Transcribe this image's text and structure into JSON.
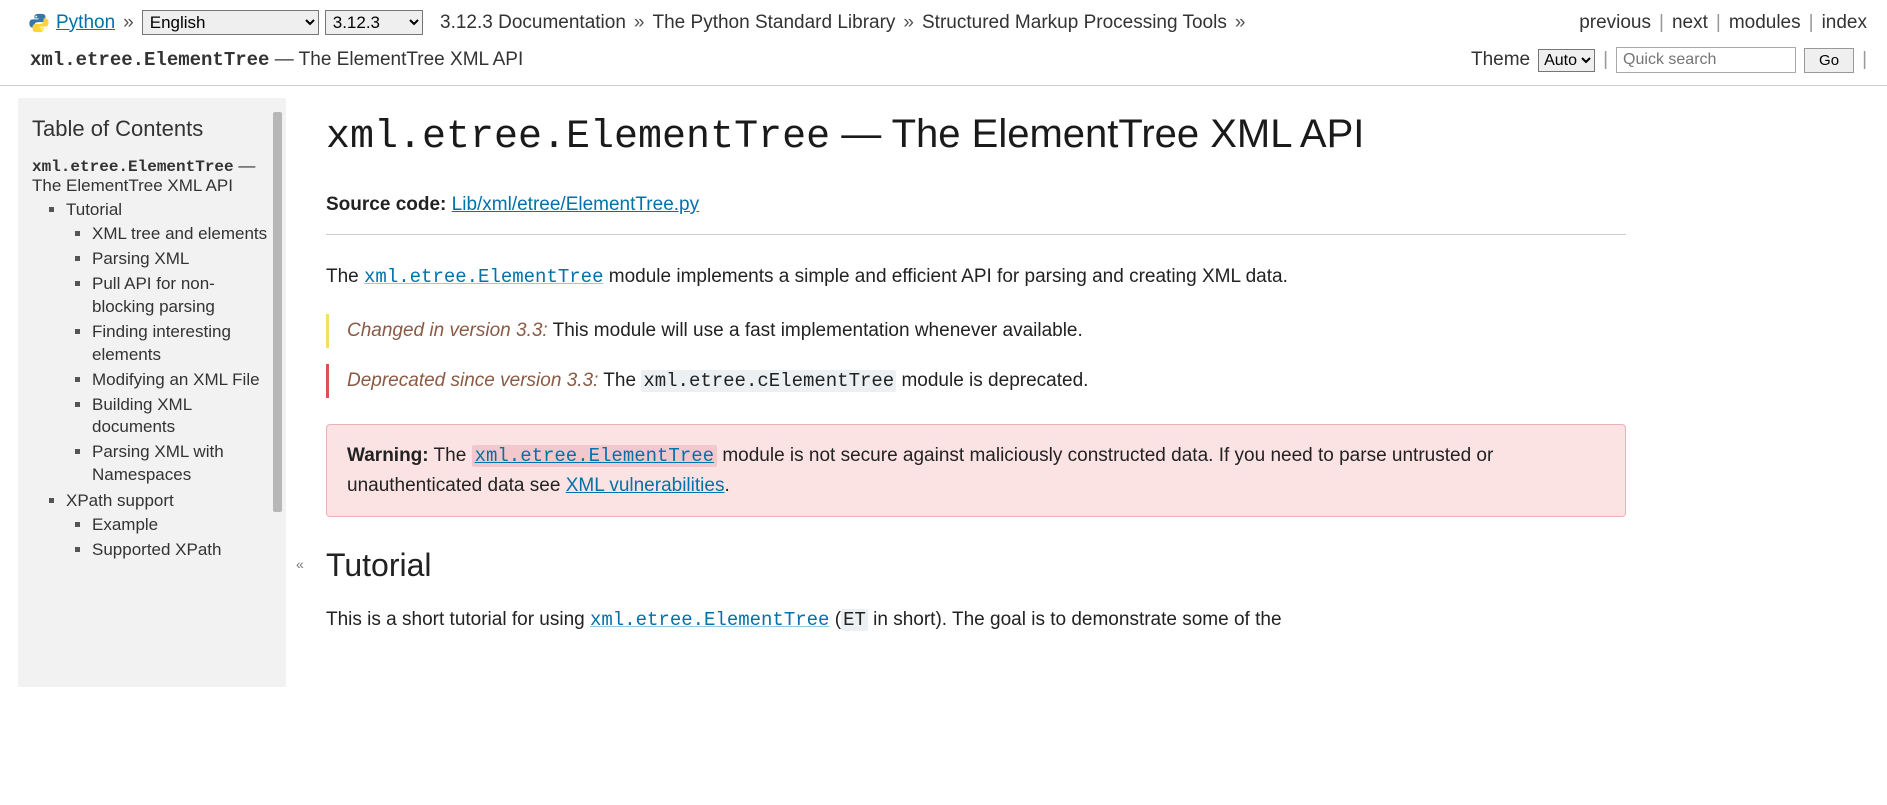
{
  "topnav": {
    "python_link": "Python",
    "lang_selected": "English",
    "ver_selected": "3.12.3",
    "breadcrumbs": [
      "3.12.3 Documentation",
      "The Python Standard Library",
      "Structured Markup Processing Tools"
    ],
    "right_links": {
      "previous": "previous",
      "next": "next",
      "modules": "modules",
      "index": "index"
    }
  },
  "secondbar": {
    "module": "xml.etree.ElementTree",
    "title_suffix": " — The ElementTree XML API",
    "theme_label": "Theme",
    "theme_selected": "Auto",
    "search_placeholder": "Quick search",
    "go": "Go"
  },
  "sidebar": {
    "heading": "Table of Contents",
    "root_mod": "xml.etree.ElementTree",
    "root_suffix": " — The ElementTree XML API",
    "items": {
      "tutorial": "Tutorial",
      "tut_children": [
        "XML tree and elements",
        "Parsing XML",
        "Pull API for non-blocking parsing",
        "Finding interesting elements",
        "Modifying an XML File",
        "Building XML documents",
        "Parsing XML with Namespaces"
      ],
      "xpath": "XPath support",
      "xpath_children": [
        "Example",
        "Supported XPath"
      ]
    }
  },
  "content": {
    "h1_mod": "xml.etree.ElementTree",
    "h1_suffix": " — The ElementTree XML API",
    "source_label": "Source code:",
    "source_link": "Lib/xml/etree/ElementTree.py",
    "intro_pre": "The ",
    "intro_mod": "xml.etree.ElementTree",
    "intro_post": " module implements a simple and efficient API for parsing and creating XML data.",
    "changed_label": "Changed in version 3.3:",
    "changed_text": " This module will use a fast implementation whenever available.",
    "deprecated_label": "Deprecated since version 3.3:",
    "deprecated_pre": " The ",
    "deprecated_mod": "xml.etree.cElementTree",
    "deprecated_post": " module is deprecated.",
    "warning_label": "Warning:",
    "warning_pre": "   The ",
    "warning_mod": "xml.etree.ElementTree",
    "warning_mid": " module is not secure against maliciously constructed data. If you need to parse untrusted or unauthenticated data see ",
    "warning_link": "XML vulnerabilities",
    "warning_end": ".",
    "h2_tutorial": "Tutorial",
    "tut_p_pre": "This is a short tutorial for using ",
    "tut_p_mod": "xml.etree.ElementTree",
    "tut_p_mid": " (",
    "tut_p_et": "ET",
    "tut_p_post": " in short). The goal is to demonstrate some of the"
  }
}
